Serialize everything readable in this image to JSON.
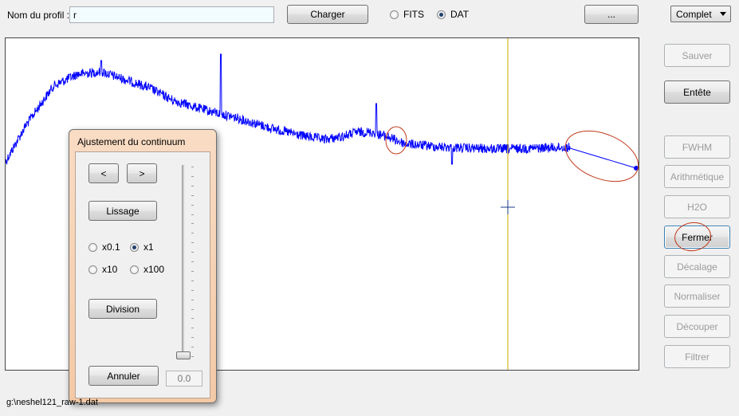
{
  "toolbar": {
    "profile_label": "Nom du profil :",
    "profile_value": "r",
    "load_button": "Charger",
    "format_options": [
      {
        "label": "FITS",
        "selected": false
      },
      {
        "label": "DAT",
        "selected": true
      }
    ],
    "browse_button": "...",
    "mode_select": "Complet"
  },
  "sidebar": {
    "buttons": [
      {
        "label": "Sauver",
        "enabled": false
      },
      {
        "label": "Entête",
        "enabled": true
      },
      {
        "label": "FWHM",
        "enabled": false
      },
      {
        "label": "Arithmétique",
        "enabled": false
      },
      {
        "label": "H2O",
        "enabled": false
      },
      {
        "label": "Fermer",
        "enabled": true
      },
      {
        "label": "Décalage",
        "enabled": false
      },
      {
        "label": "Normaliser",
        "enabled": false
      },
      {
        "label": "Découper",
        "enabled": false
      },
      {
        "label": "Filtrer",
        "enabled": false
      }
    ]
  },
  "dialog": {
    "title": "Ajustement du continuum",
    "prev_button": "<",
    "next_button": ">",
    "smooth_button": "Lissage",
    "scale_options": [
      {
        "label": "x0.1",
        "selected": false
      },
      {
        "label": "x1",
        "selected": true
      },
      {
        "label": "x10",
        "selected": false
      },
      {
        "label": "x100",
        "selected": false
      }
    ],
    "division_button": "Division",
    "cancel_button": "Annuler",
    "slider_value": "0.0"
  },
  "status_bar": {
    "file_path": "g:\\neshel121_raw-1.dat"
  },
  "colors": {
    "spectrum": "#0000ff",
    "cursor_line": "#c8a800",
    "crosshair": "#1a3d8f",
    "annotation": "#c0391b"
  }
}
